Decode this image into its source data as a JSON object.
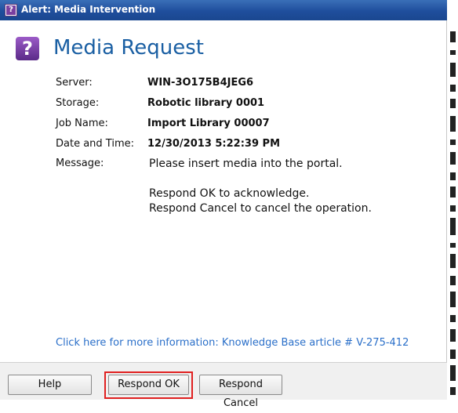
{
  "window": {
    "title": "Alert: Media Intervention"
  },
  "header": {
    "title": "Media Request",
    "icon": "question-icon"
  },
  "fields": [
    {
      "label": "Server:",
      "value": "WIN-3O175B4JEG6"
    },
    {
      "label": "Storage:",
      "value": "Robotic library 0001"
    },
    {
      "label": "Job Name:",
      "value": "Import Library 00007"
    },
    {
      "label": "Date and Time:",
      "value": "12/30/2013 5:22:39 PM"
    }
  ],
  "message": {
    "label": "Message:",
    "lines": [
      "Please insert media into the portal.",
      "Respond OK to acknowledge.",
      "Respond Cancel to cancel the operation."
    ]
  },
  "kb_link": {
    "text": "Click here for more information: Knowledge Base article # V-275-412"
  },
  "buttons": {
    "help": "Help",
    "ok": "Respond OK",
    "cancel": "Respond Cancel"
  },
  "colors": {
    "titlebar": "#1f4e9c",
    "header_text": "#1a5fa3",
    "link": "#2a6fc9",
    "highlight": "#e02020",
    "icon": "#7a3fa0"
  }
}
